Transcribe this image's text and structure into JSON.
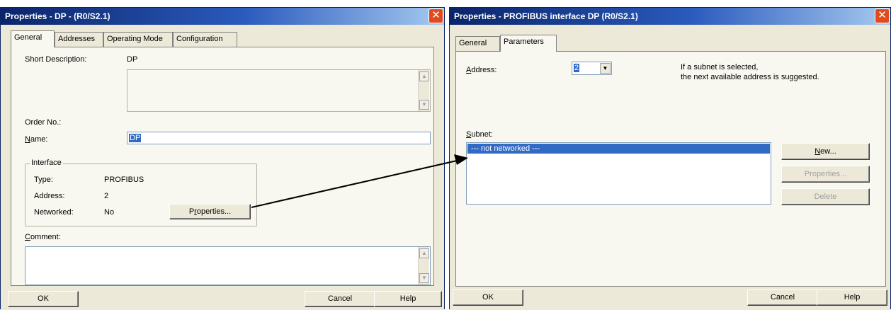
{
  "left_dialog": {
    "title": "Properties - DP - (R0/S2.1)",
    "close_symbol": "✕",
    "tabs": [
      "General",
      "Addresses",
      "Operating Mode",
      "Configuration"
    ],
    "short_description_label": "Short Description:",
    "short_description_value": "DP",
    "order_no_label": "Order No.:",
    "name_label_prefix": "N",
    "name_label_rest": "ame:",
    "name_value": "DP",
    "interface": {
      "group_label": "Interface",
      "type_label": "Type:",
      "type_value": "PROFIBUS",
      "address_label": "Address:",
      "address_value": "2",
      "networked_label": "Networked:",
      "networked_value": "No",
      "properties_button_prefix": "P",
      "properties_button_u": "r",
      "properties_button_rest": "operties..."
    },
    "comment_label_prefix": "C",
    "comment_label_rest": "omment:",
    "ok_label": "OK",
    "cancel_label": "Cancel",
    "help_label": "Help"
  },
  "right_dialog": {
    "title": "Properties - PROFIBUS interface  DP (R0/S2.1)",
    "close_symbol": "✕",
    "tabs": [
      "General",
      "Parameters"
    ],
    "address_label_prefix": "A",
    "address_label_rest": "ddress:",
    "address_value": "2",
    "hint_line1": "If a subnet is selected,",
    "hint_line2": "the next available address is suggested.",
    "subnet_label_prefix": "S",
    "subnet_label_rest": "ubnet:",
    "subnet_items": [
      "--- not networked ---"
    ],
    "new_button_prefix": "N",
    "new_button_rest": "ew...",
    "properties_button": "Properties...",
    "delete_button": "Delete",
    "ok_label": "OK",
    "cancel_label": "Cancel",
    "help_label": "Help"
  },
  "colors": {
    "title_bar": "#0a246a",
    "dialog_face": "#ece9d8",
    "selection": "#316ac5",
    "close_button": "#e04b1e"
  },
  "icons": {
    "close": "close-icon",
    "dropdown": "chevron-down-icon",
    "scroll_up": "chevron-up-icon",
    "scroll_down": "chevron-down-icon"
  }
}
